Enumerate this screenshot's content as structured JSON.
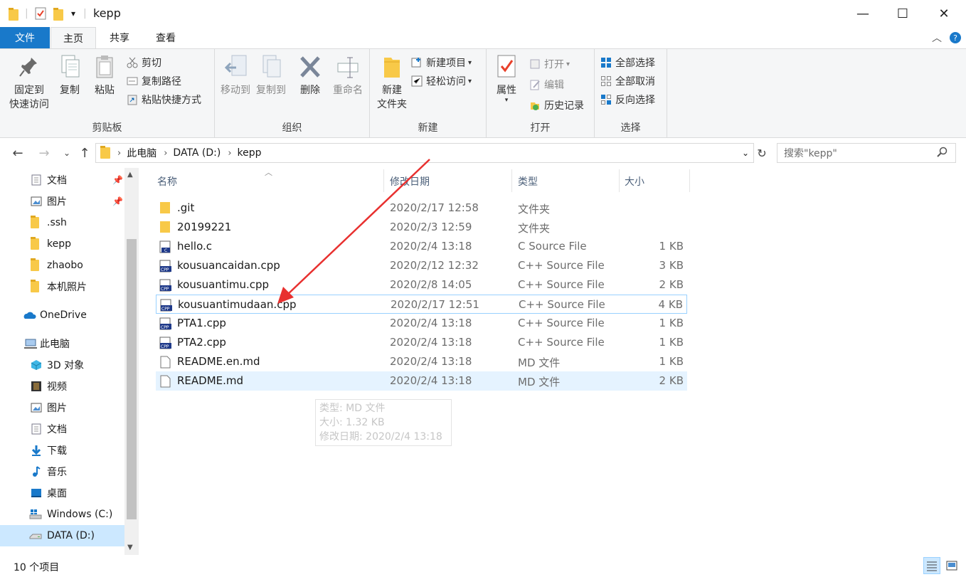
{
  "window": {
    "title": "kepp",
    "minimize_label": "—",
    "maximize_label": "☐",
    "close_label": "✕",
    "qa_dropdown": "▾",
    "sep": "|"
  },
  "tabs": {
    "file": "文件",
    "home": "主页",
    "share": "共享",
    "view": "查看",
    "collapse": "︿",
    "help": "?"
  },
  "ribbon": {
    "clipboard": {
      "label": "剪贴板",
      "pin_line1": "固定到",
      "pin_line2": "快速访问",
      "copy": "复制",
      "paste": "粘贴",
      "cut": "剪切",
      "copy_path": "复制路径",
      "paste_shortcut": "粘贴快捷方式"
    },
    "organize": {
      "label": "组织",
      "move_to": "移动到",
      "copy_to": "复制到",
      "delete": "删除",
      "rename": "重命名"
    },
    "new": {
      "label": "新建",
      "new_folder_line1": "新建",
      "new_folder_line2": "文件夹",
      "new_item": "新建项目",
      "easy_access": "轻松访问"
    },
    "open": {
      "label": "打开",
      "properties": "属性",
      "open": "打开",
      "edit": "编辑",
      "history": "历史记录"
    },
    "select": {
      "label": "选择",
      "select_all": "全部选择",
      "select_none": "全部取消",
      "invert": "反向选择"
    }
  },
  "address": {
    "crumbs": [
      "此电脑",
      "DATA (D:)",
      "kepp"
    ],
    "chevron": "›",
    "search_placeholder": "搜索\"kepp\""
  },
  "nav": {
    "items": [
      "文档",
      "图片",
      ".ssh",
      "kepp",
      "zhaobo",
      "本机照片",
      "OneDrive",
      "此电脑",
      "3D 对象",
      "视频",
      "图片",
      "文档",
      "下载",
      "音乐",
      "桌面",
      "Windows (C:)",
      "DATA (D:)"
    ]
  },
  "list": {
    "headers": {
      "name": "名称",
      "date": "修改日期",
      "type": "类型",
      "size": "大小"
    },
    "sort_indicator": "︿",
    "files": [
      {
        "name": ".git",
        "date": "2020/2/17 12:58",
        "type": "文件夹",
        "size": "",
        "icon": "folder-icon"
      },
      {
        "name": "20199221",
        "date": "2020/2/3 12:59",
        "type": "文件夹",
        "size": "",
        "icon": "folder-icon"
      },
      {
        "name": "hello.c",
        "date": "2020/2/4 13:18",
        "type": "C Source File",
        "size": "1 KB",
        "icon": "c-file-icon"
      },
      {
        "name": "kousuancaidan.cpp",
        "date": "2020/2/12 12:32",
        "type": "C++ Source File",
        "size": "3 KB",
        "icon": "cpp-file-icon"
      },
      {
        "name": "kousuantimu.cpp",
        "date": "2020/2/8 14:05",
        "type": "C++ Source File",
        "size": "2 KB",
        "icon": "cpp-file-icon"
      },
      {
        "name": "kousuantimudaan.cpp",
        "date": "2020/2/17 12:51",
        "type": "C++ Source File",
        "size": "4 KB",
        "icon": "cpp-file-icon"
      },
      {
        "name": "PTA1.cpp",
        "date": "2020/2/4 13:18",
        "type": "C++ Source File",
        "size": "1 KB",
        "icon": "cpp-file-icon"
      },
      {
        "name": "PTA2.cpp",
        "date": "2020/2/4 13:18",
        "type": "C++ Source File",
        "size": "1 KB",
        "icon": "cpp-file-icon"
      },
      {
        "name": "README.en.md",
        "date": "2020/2/4 13:18",
        "type": "MD 文件",
        "size": "1 KB",
        "icon": "document-icon"
      },
      {
        "name": "README.md",
        "date": "2020/2/4 13:18",
        "type": "MD 文件",
        "size": "2 KB",
        "icon": "document-icon"
      }
    ]
  },
  "tooltip": {
    "line1": "类型: MD 文件",
    "line2": "大小: 1.32 KB",
    "line3": "修改日期: 2020/2/4 13:18"
  },
  "status": {
    "count": "10 个项目"
  },
  "colors": {
    "accent": "#1979ca",
    "selection": "#cce8ff",
    "hover": "#e5f3ff",
    "annotation_arrow": "#e8302f"
  }
}
